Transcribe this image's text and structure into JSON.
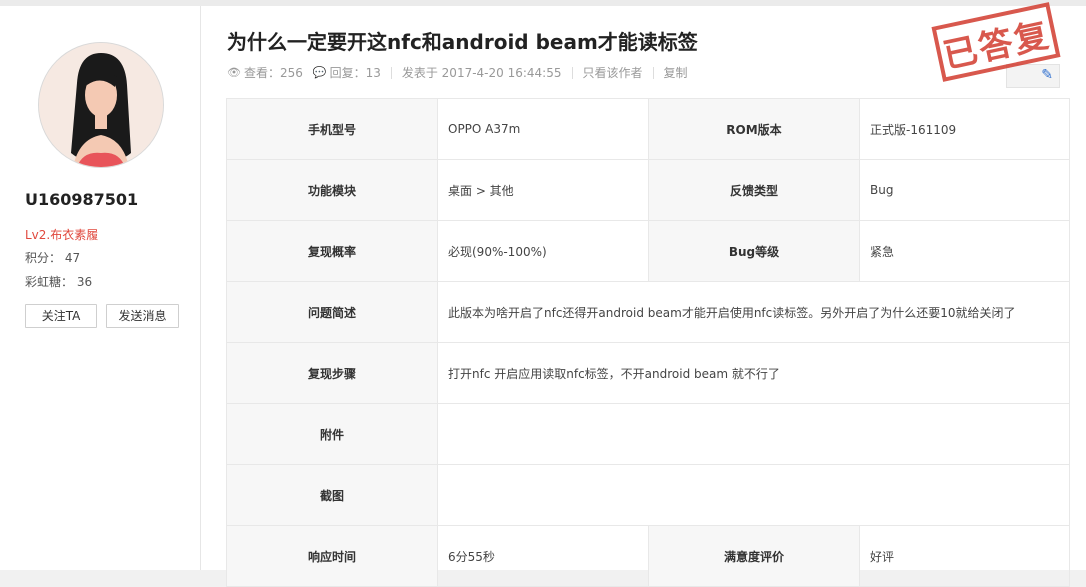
{
  "sidebar": {
    "username": "U160987501",
    "level": "Lv2.布衣素履",
    "points": "积分： 47",
    "candy": "彩虹糖： 36",
    "follow_label": "关注TA",
    "message_label": "发送消息"
  },
  "post": {
    "title": "为什么一定要开这nfc和android beam才能读标签",
    "views": "查看：256",
    "replies": "回复：13",
    "posted": "发表于 2017-4-20 16:44:55",
    "author_only": "只看该作者",
    "copy": "复制",
    "stamp": "已答复"
  },
  "table": {
    "phone_model_label": "手机型号",
    "phone_model": "OPPO A37m",
    "rom_label": "ROM版本",
    "rom": "正式版-161109",
    "module_label": "功能模块",
    "module": "桌面 > 其他",
    "feedback_type_label": "反馈类型",
    "feedback_type": "Bug",
    "repro_rate_label": "复现概率",
    "repro_rate": "必现(90%-100%)",
    "bug_level_label": "Bug等级",
    "bug_level": "紧急",
    "summary_label": "问题简述",
    "summary": "此版本为啥开启了nfc还得开android beam才能开启使用nfc读标签。另外开启了为什么还要10就给关闭了",
    "steps_label": "复现步骤",
    "steps": "打开nfc 开启应用读取nfc标签，不开android beam 就不行了",
    "attachment_label": "附件",
    "screenshot_label": "截图",
    "response_label": "响应时间",
    "response": "6分55秒",
    "satisfaction_label": "满意度评价",
    "satisfaction": "好评"
  },
  "colors": {
    "accent_red": "#e0302a",
    "stamp_red": "#d23b2f",
    "edit_blue": "#2f6fcf"
  }
}
